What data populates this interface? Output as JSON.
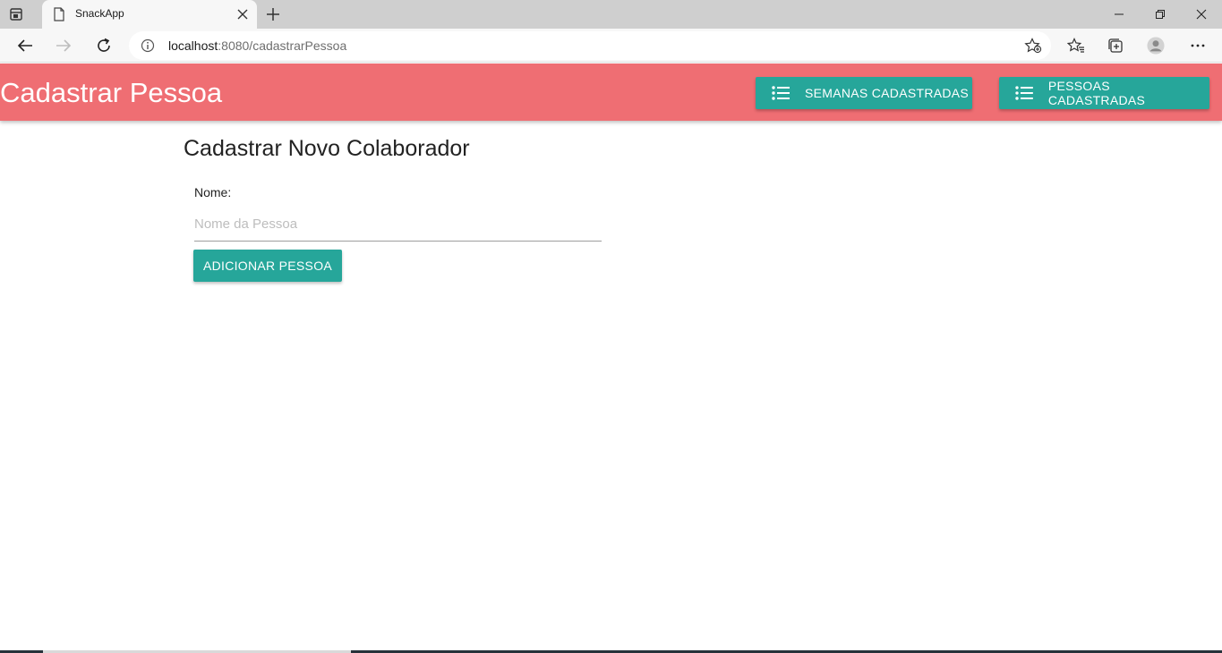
{
  "browser": {
    "tab_title": "SnackApp",
    "url_host": "localhost",
    "url_rest": ":8080/cadastrarPessoa",
    "icons": [
      "tab-actions-icon",
      "page-icon",
      "close-icon",
      "plus-icon",
      "minimize-icon",
      "restore-icon",
      "window-close-icon",
      "back-arrow-icon",
      "forward-arrow-icon",
      "reload-icon",
      "info-icon",
      "add-favorite-icon",
      "favorites-icon",
      "collections-icon",
      "profile-icon",
      "more-icon"
    ]
  },
  "app": {
    "brand": "Cadastrar Pessoa",
    "nav": {
      "semanas_label": "SEMANAS CADASTRADAS",
      "pessoas_label": "PESSOAS CADASTRADAS"
    },
    "form": {
      "title": "Cadastrar Novo Colaborador",
      "name_label": "Nome:",
      "name_placeholder": "Nome da Pessoa",
      "name_value": "",
      "submit_label": "ADICIONAR PESSOA"
    },
    "colors": {
      "appbar": "#ef6e73",
      "accent": "#26a69a"
    }
  }
}
